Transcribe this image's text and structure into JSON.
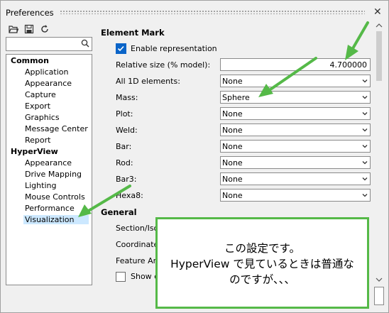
{
  "window": {
    "title": "Preferences",
    "close_glyph": "✕"
  },
  "toolbar": {
    "icons": [
      "open-folder-icon",
      "save-icon",
      "refresh-icon"
    ]
  },
  "search": {
    "value": "",
    "icon": "search-icon"
  },
  "tree": {
    "groups": [
      {
        "label": "Common",
        "items": [
          "Application",
          "Appearance",
          "Capture",
          "Export",
          "Graphics",
          "Message Center",
          "Report"
        ]
      },
      {
        "label": "HyperView",
        "items": [
          "Appearance",
          "Drive Mapping",
          "Lighting",
          "Mouse Controls",
          "Performance",
          "Visualization"
        ]
      }
    ],
    "selected": "Visualization"
  },
  "element_mark": {
    "heading": "Element Mark",
    "enable_label": "Enable representation",
    "enable_checked": true,
    "relative_size_label": "Relative size (% model):",
    "relative_size_value": "4.700000",
    "rows": [
      {
        "label": "All 1D elements:",
        "value": "None"
      },
      {
        "label": "Mass:",
        "value": "Sphere"
      },
      {
        "label": "Plot:",
        "value": "None"
      },
      {
        "label": "Weld:",
        "value": "None"
      },
      {
        "label": "Bar:",
        "value": "None"
      },
      {
        "label": "Rod:",
        "value": "None"
      },
      {
        "label": "Bar3:",
        "value": "None"
      },
      {
        "label": "Hexa8:",
        "value": "None"
      }
    ]
  },
  "general": {
    "heading": "General",
    "rows_partial": [
      "Section/Iso",
      "Coordinate",
      "Feature An"
    ],
    "show_label_partial": "Show e"
  },
  "annotation": {
    "line1": "この設定です。",
    "line2": "HyperView で見ているときは普通な",
    "line3": "のですが、、、",
    "border_color": "#55b948"
  },
  "colors": {
    "arrow": "#55b948",
    "selection": "#cce8ff",
    "checkbox": "#0a64c8"
  }
}
